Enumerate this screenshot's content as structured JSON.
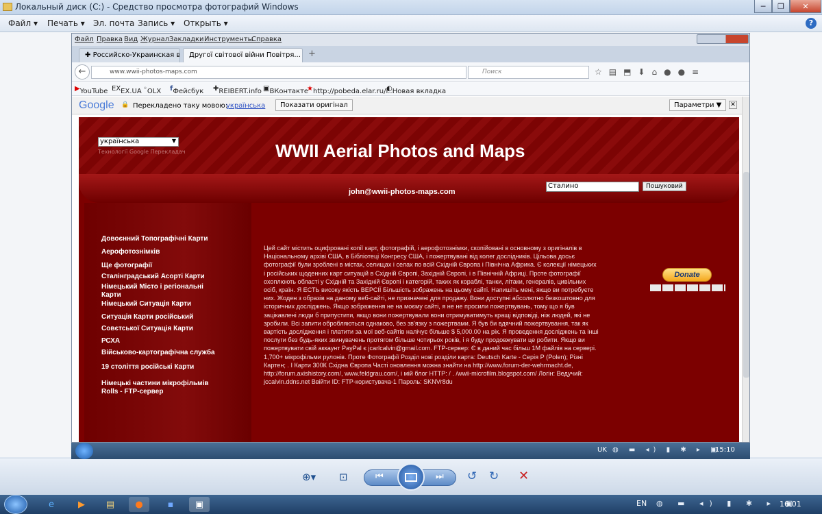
{
  "viewer": {
    "title": "Локальный диск (C:) - Средство просмотра фотографий Windows",
    "menu": [
      "Файл ▾",
      "Печать ▾",
      "Эл. почта",
      "Запись ▾",
      "Открыть ▾"
    ],
    "help": "?"
  },
  "firefox": {
    "menu": [
      "Файл",
      "Правка",
      "Вид",
      "Журнал",
      "Закладки",
      "Инструменты",
      "Справка"
    ],
    "tabs": [
      "Российско-Украинская в...",
      "Другої світової війни Повітря..."
    ],
    "url": "www.wwii-photos-maps.com",
    "search_placeholder": "Поиск",
    "bookmarks": [
      "YouTube",
      "EX.UA",
      "OLX",
      "Фейсбук",
      "REIBERT.info",
      "ВКонтакте",
      "http://pobeda.elar.ru/i...",
      "Новая вкладка"
    ]
  },
  "translate_bar": {
    "google": "Google",
    "translated_to": "Перекладено таку мовою:",
    "language": "українська",
    "show_original": "Показати оригінал",
    "options": "Параметри ▼"
  },
  "site": {
    "language_select": "українська",
    "powered_by": "Технології Google Перекладач",
    "title": "WWII Aerial Photos and Maps",
    "email": "john@wwii-photos-maps.com",
    "search_value": "Сталино",
    "search_button": "Пошуковий",
    "donate": "Donate",
    "sidebar": [
      "Довоєнний Топографічні Карти",
      "Аерофотознімків",
      "Ще фотографії",
      "Сталінградський Асорті Карти",
      "Німецький Місто і регіональні Карти",
      "Німецький Ситуація Карти",
      "Ситуація Карти російський",
      "Совєтської Ситуація Карти",
      "РСХА",
      "Військово-картографічна служба",
      "19 століття російські Карти",
      "Німецькі частини мікрофільмів Rolls - FTP-сервер"
    ],
    "body": "Цей сайт містить оцифровані копії карт, фотографій, і аерофотознімки, скопійовані в основному з оригіналів в Національному архіві США, в Бібліотеці Конгресу США, і пожертвувані від колег дослідників. Цільова досьє фотографії були зроблені в містах, селищах і селах по всій Східній Європа і Північна Африка. Є колекції німецьких і російських щоденних карт ситуацій в Східній Європі, Західній Європі, і в Північній Африці. Проте фотографії охоплюють області у Східній та Західній Європі і категорій, таких як кораблі, танки, літаки, генералів, цивільних осіб, країн. Я ЕСТЬ високу якість ВЕРСІЇ Більшість зображень на цьому сайті. Напишіть мені, якщо ви потребуєте них. Жоден з образів на даному веб-сайті, не призначені для продажу. Вони доступні абсолютно безкоштовно для історичних досліджень. Якщо зображення не на моєму сайті, я не не просили пожертвувань, тому що я був зацікавлені люди б припустити, якщо вони пожертвували вони отримуватимуть кращі відповіді, ніж людей, які не зробили. Всі запити обробляються однаково, без зв'язку з пожертвами. Я був би вдячний пожертвування, так як вартість дослідження і платити за мої веб-сайтів налічує більше $ 5,000.00 на рік. Я проведення досліджень та інші послуги без будь-яких звинувачень протягом більше чотирьох років, і я буду продовжувати це робити. Якщо ви пожертвувати свій аккаунт PayPal є jcarlcalvin@gmail.com. FTP-сервер: Є в даний час більш 1М файлів на сервері. 1,700+ мікрофільми рулонів. Проте Фотографії Розділ нові розділи карта: Deutsch Karte - Серія Р (Polen); Різні Картен; . І Карти 300К Східна Європа Часті оновлення можна знайти на http://www.forum-der-wehrmacht.de, http://forum.axishistory.com/, www.feldgrau.com/, і мій блог HTTP: / . /wwii-microfilm.blogspot.com/ Логін: Ведучий: jccalvin.ddns.net Ввійти ID: FTP-користувача-1 Пароль: SKNVr8du"
  },
  "inner_taskbar": {
    "lang": "UK",
    "clock": "15:10"
  },
  "taskbar": {
    "lang": "EN",
    "clock": "16:01"
  }
}
